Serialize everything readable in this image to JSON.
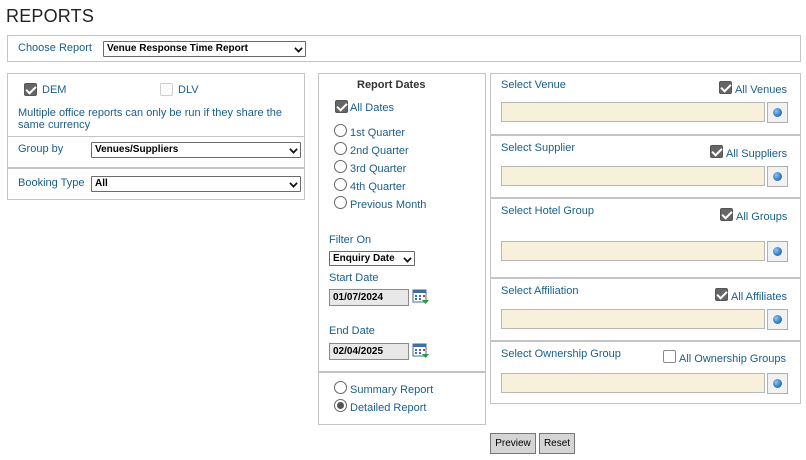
{
  "page": {
    "title": "REPORTS"
  },
  "choose_report": {
    "label": "Choose Report",
    "value": "Venue Response Time Report"
  },
  "offices": {
    "dem": {
      "label": "DEM",
      "checked": true
    },
    "dlv": {
      "label": "DLV",
      "checked": false
    },
    "note_line1": "Multiple office reports can only be run if they share the",
    "note_line2": "same currency"
  },
  "group_by": {
    "label": "Group by",
    "value": "Venues/Suppliers"
  },
  "booking_type": {
    "label": "Booking Type",
    "value": "All"
  },
  "report_dates": {
    "title": "Report Dates",
    "all_dates": "All Dates",
    "options": [
      "1st Quarter",
      "2nd Quarter",
      "3rd Quarter",
      "4th Quarter",
      "Previous Month"
    ],
    "filter_on_label": "Filter On",
    "filter_on_value": "Enquiry Date",
    "start_date_label": "Start Date",
    "start_date": "01/07/2024",
    "end_date_label": "End Date",
    "end_date": "02/04/2025"
  },
  "report_type": {
    "summary": "Summary Report",
    "detailed": "Detailed Report",
    "selected": "detailed"
  },
  "selectors": {
    "venue": {
      "label": "Select Venue",
      "all_label": "All Venues",
      "checked": true
    },
    "supplier": {
      "label": "Select Supplier",
      "all_label": "All Suppliers",
      "checked": true
    },
    "hotel_group": {
      "label": "Select Hotel Group",
      "all_label": "All Groups",
      "checked": true
    },
    "affiliation": {
      "label": "Select Affiliation",
      "all_label": "All Affiliates",
      "checked": true
    },
    "ownership": {
      "label": "Select Ownership Group",
      "all_label": "All Ownership Groups",
      "checked": false
    }
  },
  "buttons": {
    "preview": "Preview",
    "reset": "Reset"
  }
}
